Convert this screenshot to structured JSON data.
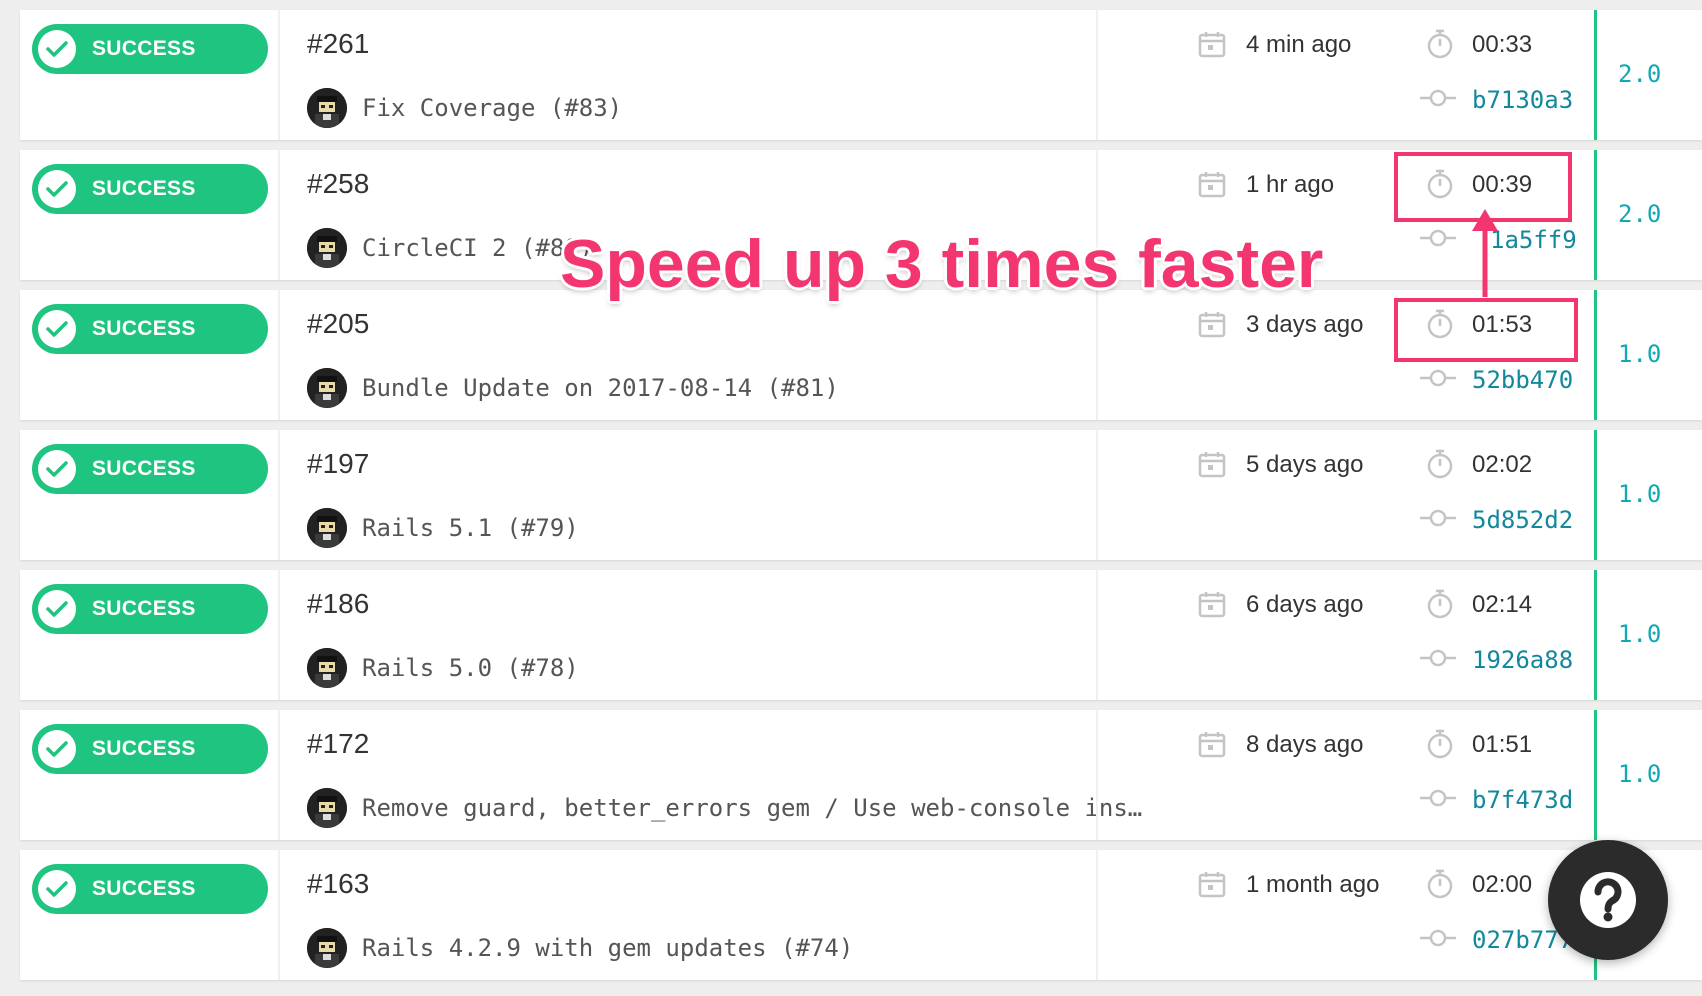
{
  "builds": [
    {
      "status": "SUCCESS",
      "number": "#261",
      "message": "Fix Coverage (#83)",
      "time_ago": "4 min ago",
      "duration": "00:33",
      "sha": "b7130a3",
      "version": "2.0"
    },
    {
      "status": "SUCCESS",
      "number": "#258",
      "message": "CircleCI 2 (#80)",
      "time_ago": "1 hr ago",
      "duration": "00:39",
      "sha": "1a5ff9",
      "version": "2.0"
    },
    {
      "status": "SUCCESS",
      "number": "#205",
      "message": "Bundle Update on 2017-08-14 (#81)",
      "time_ago": "3 days ago",
      "duration": "01:53",
      "sha": "52bb470",
      "version": "1.0"
    },
    {
      "status": "SUCCESS",
      "number": "#197",
      "message": "Rails 5.1 (#79)",
      "time_ago": "5 days ago",
      "duration": "02:02",
      "sha": "5d852d2",
      "version": "1.0"
    },
    {
      "status": "SUCCESS",
      "number": "#186",
      "message": "Rails 5.0 (#78)",
      "time_ago": "6 days ago",
      "duration": "02:14",
      "sha": "1926a88",
      "version": "1.0"
    },
    {
      "status": "SUCCESS",
      "number": "#172",
      "message": "Remove guard, better_errors gem / Use web-console ins…",
      "time_ago": "8 days ago",
      "duration": "01:51",
      "sha": "b7f473d",
      "version": "1.0"
    },
    {
      "status": "SUCCESS",
      "number": "#163",
      "message": "Rails 4.2.9 with gem updates (#74)",
      "time_ago": "1 month ago",
      "duration": "02:00",
      "sha": "027b777",
      "version": ""
    }
  ],
  "annotation": {
    "text": "Speed up 3 times faster"
  },
  "help": {
    "icon": "question-icon"
  },
  "colors": {
    "success": "#1ec47f",
    "highlight": "#f3366f",
    "sha": "#11889c",
    "version": "#0fa9b5"
  }
}
